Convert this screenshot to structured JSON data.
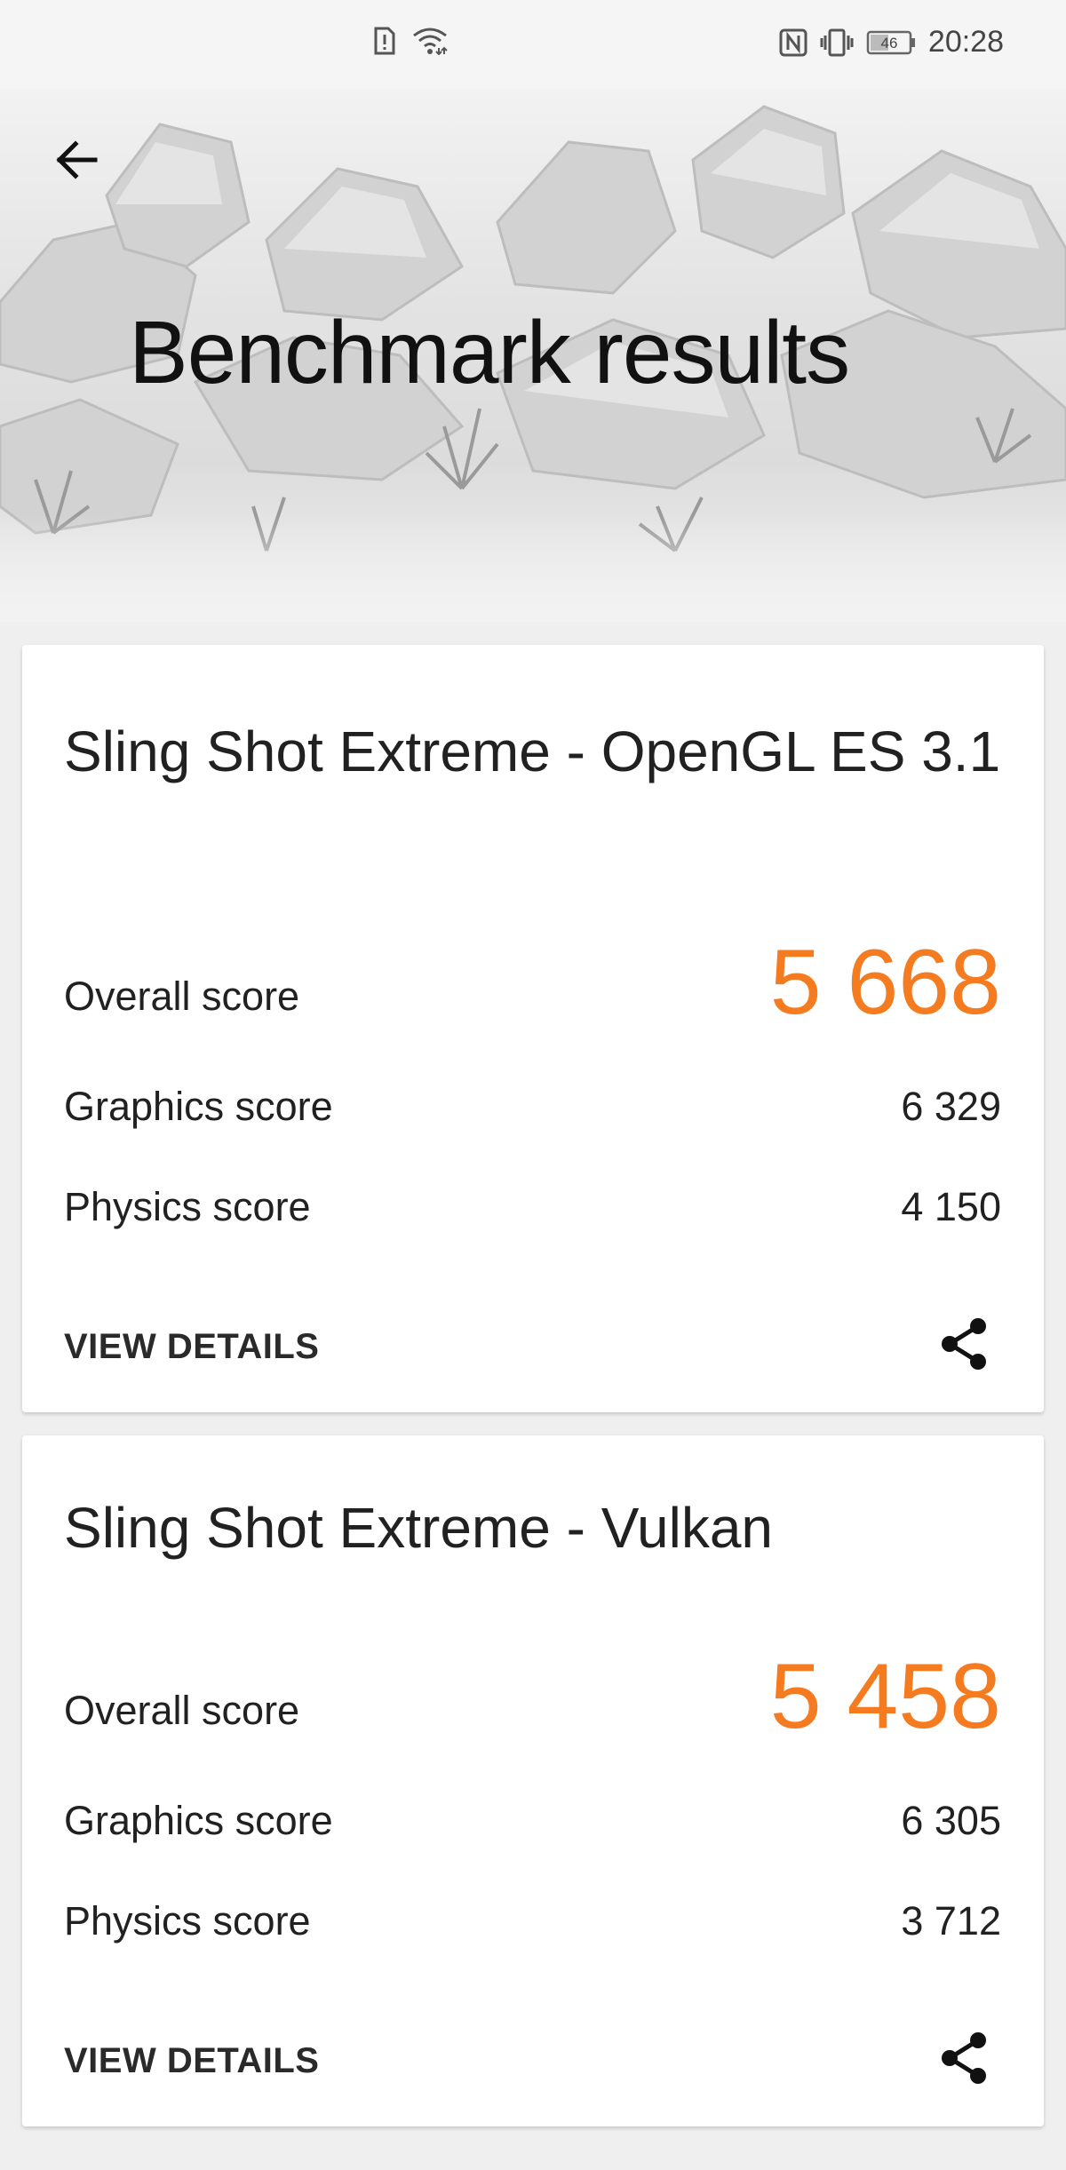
{
  "status_bar": {
    "time": "20:28",
    "battery_level": "46",
    "icons": [
      "sim-alert-icon",
      "wifi-icon",
      "nfc-icon",
      "vibrate-icon",
      "battery-icon"
    ]
  },
  "header": {
    "title": "Benchmark results",
    "back_icon": "arrow-left-icon"
  },
  "results": [
    {
      "test_name": "Sling Shot Extreme - OpenGL ES 3.1",
      "overall_label": "Overall score",
      "overall_value": "5 668",
      "graphics_label": "Graphics score",
      "graphics_value": "6 329",
      "physics_label": "Physics score",
      "physics_value": "4 150",
      "details_label": "VIEW DETAILS",
      "share_icon": "share-icon"
    },
    {
      "test_name": "Sling Shot Extreme - Vulkan",
      "overall_label": "Overall score",
      "overall_value": "5 458",
      "graphics_label": "Graphics score",
      "graphics_value": "6 305",
      "physics_label": "Physics score",
      "physics_value": "3 712",
      "details_label": "VIEW DETAILS",
      "share_icon": "share-icon"
    }
  ],
  "colors": {
    "accent": "#f47b20",
    "background": "#efefef",
    "card": "#ffffff",
    "text": "#212121"
  }
}
